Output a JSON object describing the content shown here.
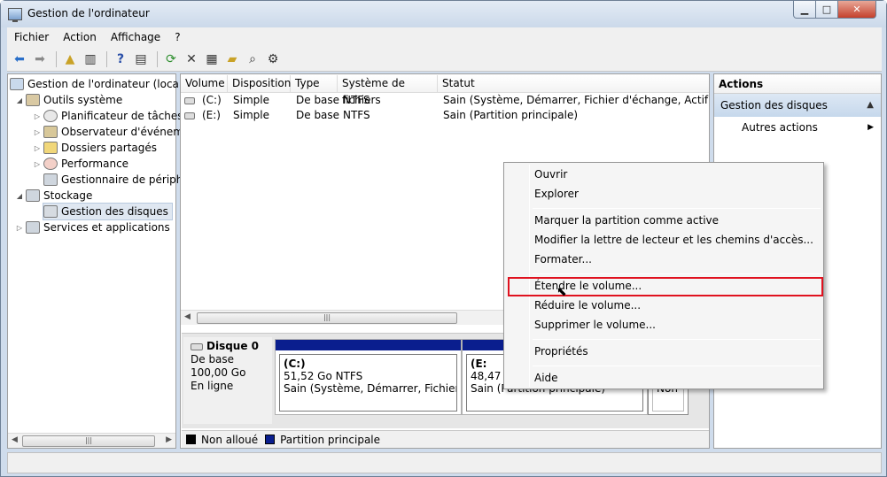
{
  "window": {
    "title": "Gestion de l'ordinateur"
  },
  "menu": [
    "Fichier",
    "Action",
    "Affichage",
    "?"
  ],
  "tree": {
    "root": "Gestion de l'ordinateur (local)",
    "system_tools": "Outils système",
    "task_scheduler": "Planificateur de tâches",
    "event_viewer": "Observateur d'événeme",
    "shared_folders": "Dossiers partagés",
    "performance": "Performance",
    "device_manager": "Gestionnaire de périphé",
    "storage": "Stockage",
    "disk_management": "Gestion des disques",
    "services": "Services et applications"
  },
  "volumes": {
    "headers": [
      "Volume",
      "Disposition",
      "Type",
      "Système de fichiers",
      "Statut"
    ],
    "rows": [
      {
        "volume": "(C:)",
        "layout": "Simple",
        "type": "De base",
        "fs": "NTFS",
        "status": "Sain (Système, Démarrer, Fichier d'échange, Actif, Vidage"
      },
      {
        "volume": "(E:)",
        "layout": "Simple",
        "type": "De base",
        "fs": "NTFS",
        "status": "Sain (Partition principale)"
      }
    ]
  },
  "disk": {
    "name": "Disque 0",
    "type": "De base",
    "size": "100,00 Go",
    "state": "En ligne",
    "c": {
      "label": "(C:)",
      "size": "51,52 Go NTFS",
      "status": "Sain (Système, Démarrer, Fichier d'éc"
    },
    "e": {
      "label": "(E:",
      "size": "48,47 Go",
      "status": "Sain (Partition principale)"
    },
    "unalloc_label": "Non"
  },
  "legend": {
    "unallocated": "Non alloué",
    "primary": "Partition principale"
  },
  "actions": {
    "header": "Actions",
    "section": "Gestion des disques",
    "more": "Autres actions"
  },
  "context_menu": {
    "open": "Ouvrir",
    "explore": "Explorer",
    "mark_active": "Marquer la partition comme active",
    "change_letter": "Modifier la lettre de lecteur et les chemins d'accès...",
    "format": "Formater...",
    "extend": "Étendre le volume...",
    "shrink": "Réduire le volume...",
    "delete": "Supprimer le volume...",
    "properties": "Propriétés",
    "help": "Aide"
  },
  "colors": {
    "primary_partition": "#0a1e8e",
    "unallocated": "#000000",
    "highlight": "#e0121f"
  }
}
